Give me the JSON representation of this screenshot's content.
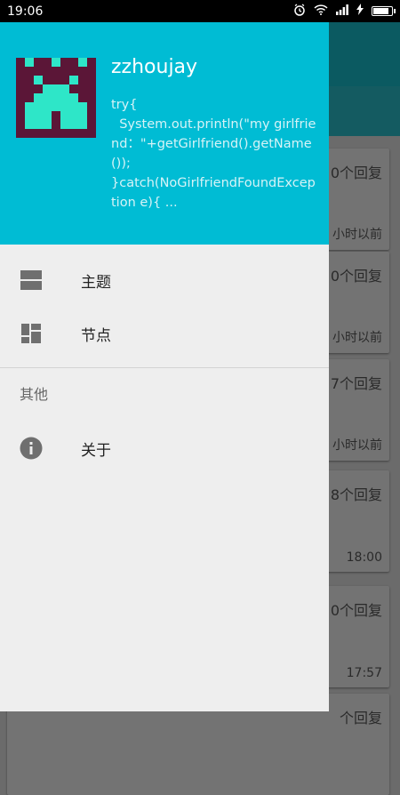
{
  "status_bar": {
    "time": "19:06",
    "battery_level": 0.9
  },
  "drawer": {
    "user": {
      "name": "zzhoujay",
      "bio": "try{\n  System.out.println(\"my girlfriend：\"+getGirlfriend().getName());\n}catch(NoGirlfriendFoundException e){ ..."
    },
    "menu": [
      {
        "label": "主题",
        "icon": "topics-icon"
      },
      {
        "label": "节点",
        "icon": "nodes-icon"
      }
    ],
    "section_label": "其他",
    "other_menu": [
      {
        "label": "关于",
        "icon": "info-icon"
      }
    ]
  },
  "background_list": [
    {
      "replies": "0个回复",
      "time": "小时以前"
    },
    {
      "replies": "0个回复",
      "time": "小时以前"
    },
    {
      "replies": "7个回复",
      "time": "小时以前"
    },
    {
      "replies": "8个回复",
      "time": "18:00"
    },
    {
      "replies": "0个回复",
      "time": "17:57"
    },
    {
      "replies": "个回复",
      "time": ""
    }
  ],
  "colors": {
    "accent": "#00bcd4",
    "drawer_bg": "#eeeeee",
    "avatar_primary": "#5b1637",
    "avatar_secondary": "#2ee6c8"
  }
}
